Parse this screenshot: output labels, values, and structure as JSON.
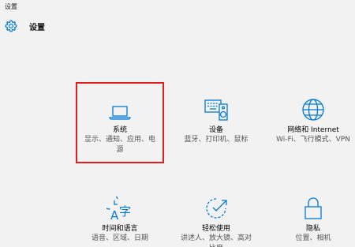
{
  "window": {
    "title": "设置"
  },
  "header": {
    "title": "设置",
    "icon": "gear-icon"
  },
  "accent_color": "#0078d7",
  "highlight_color": "#e21d1d",
  "tiles": [
    {
      "icon": "laptop-icon",
      "title": "系统",
      "desc": "显示、通知、应用、电源"
    },
    {
      "icon": "devices-icon",
      "title": "设备",
      "desc": "蓝牙、打印机、鼠标"
    },
    {
      "icon": "globe-icon",
      "title": "网络和 Internet",
      "desc": "Wi-Fi、飞行模式、VPN"
    },
    {
      "icon": "time-language-icon",
      "title": "时间和语言",
      "desc": "语音、区域、日期"
    },
    {
      "icon": "ease-of-access-icon",
      "title": "轻松使用",
      "desc": "讲述人、放大镜、高对比度"
    },
    {
      "icon": "lock-icon",
      "title": "隐私",
      "desc": "位置、相机"
    }
  ]
}
